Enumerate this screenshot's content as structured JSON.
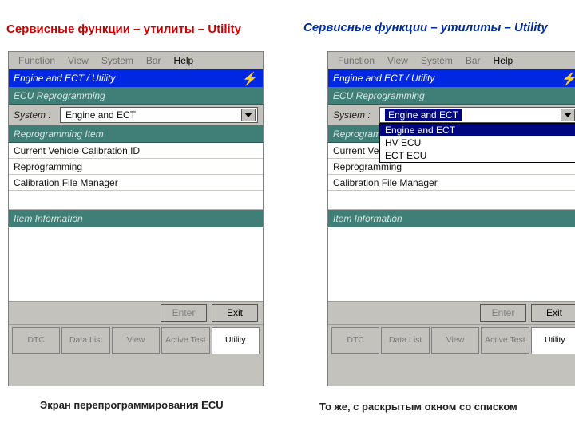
{
  "titles": {
    "left": "Сервисные функции – утилиты – Utility",
    "right": "Сервисные функции – утилиты – Utility"
  },
  "captions": {
    "left": "Экран перепрограммирования ECU",
    "right": "То же, с раскрытым окном со списком"
  },
  "menu": {
    "function": "Function",
    "view": "View",
    "system": "System",
    "bar": "Bar",
    "help": "Help"
  },
  "bluebar": {
    "title": "Engine and ECT / Utility"
  },
  "sections": {
    "ecu_reprog": "ECU Reprogramming",
    "reprog_item": "Reprogramming Item",
    "item_info": "Item Information"
  },
  "system_row": {
    "label": "System :",
    "value": "Engine and ECT"
  },
  "dropdown": {
    "items": [
      "Engine and ECT",
      "HV ECU",
      "ECT ECU"
    ]
  },
  "list": {
    "r1": "Current Vehicle Calibration ID",
    "r2": "Reprogramming",
    "r3": "Calibration File Manager"
  },
  "buttons": {
    "enter": "Enter",
    "exit": "Exit"
  },
  "tabs": {
    "dtc": "DTC",
    "datalist": "Data\nList",
    "view": "View",
    "active": "Active\nTest",
    "utility": "Utility"
  }
}
